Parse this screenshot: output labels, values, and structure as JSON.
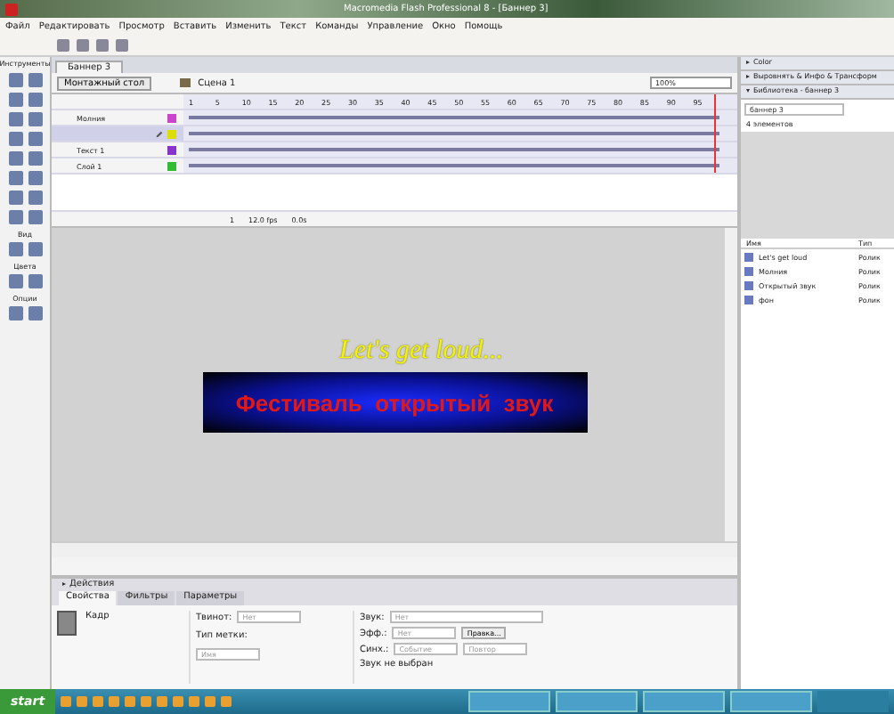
{
  "window": {
    "title": "Macromedia Flash Professional 8 - [Баннер 3]"
  },
  "menu": [
    "Файл",
    "Редактировать",
    "Просмотр",
    "Вставить",
    "Изменить",
    "Текст",
    "Команды",
    "Управление",
    "Окно",
    "Помощь"
  ],
  "tools_panel": {
    "title": "Инструменты",
    "sections": [
      "Вид",
      "Цвета",
      "Опции"
    ]
  },
  "document": {
    "tab": "Баннер 3",
    "stage_button": "Монтажный стол",
    "scene": "Сцена 1",
    "zoom": "100%"
  },
  "timeline": {
    "frame_numbers": [
      "1",
      "5",
      "10",
      "15",
      "20",
      "25",
      "30",
      "35",
      "40",
      "45",
      "50",
      "55",
      "60",
      "65",
      "70",
      "75",
      "80",
      "85",
      "90",
      "95"
    ],
    "layers": [
      {
        "name": "Молния",
        "selected": false,
        "color": "#cc44cc"
      },
      {
        "selected": true,
        "color": "#dddd00"
      },
      {
        "name": "Текст 1",
        "selected": false,
        "color": "#8833cc"
      },
      {
        "name": "Слой 1",
        "selected": false,
        "color": "#33bb33"
      }
    ],
    "frame": "1",
    "fps": "12.0 fps",
    "time": "0.0s"
  },
  "stage": {
    "headline": "Let's get loud...",
    "banner": "Фестиваль  открытый  звук"
  },
  "panels": {
    "actions": "Действия",
    "tabs": [
      {
        "label": "Свойства",
        "selected": true
      },
      {
        "label": "Фильтры",
        "selected": false
      },
      {
        "label": "Параметры",
        "selected": false
      }
    ]
  },
  "properties": {
    "kind": "Кадр",
    "tween_label": "Твинот:",
    "tween": "Нет",
    "sound_label": "Звук:",
    "sound": "Нет",
    "effect_label": "Эфф.:",
    "effect": "Нет",
    "edit_button": "Правка...",
    "label_type_label": "Тип метки:",
    "label_type": "Имя",
    "sync_label": "Синх.:",
    "sync": "Событие",
    "repeat": "Повтор",
    "sound_status": "Звук не выбран"
  },
  "right_panels": [
    {
      "title": "Color",
      "expanded": false
    },
    {
      "title": "Выровнять & Инфо & Трансформ",
      "expanded": false
    },
    {
      "title": "Библиотека - баннер 3",
      "expanded": true
    }
  ],
  "library": {
    "document": "баннер 3",
    "count": "4 элементов",
    "columns": [
      "Имя",
      "Тип"
    ],
    "items": [
      {
        "name": "Let's get loud",
        "type": "Ролик"
      },
      {
        "name": "Молния",
        "type": "Ролик"
      },
      {
        "name": "Открытый звук",
        "type": "Ролик"
      },
      {
        "name": "фон",
        "type": "Ролик"
      }
    ]
  },
  "taskbar": {
    "start": "start"
  }
}
